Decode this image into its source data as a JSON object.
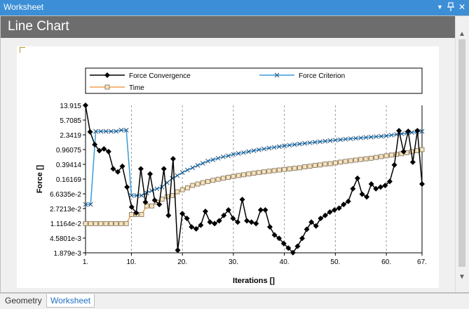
{
  "window": {
    "title": "Worksheet",
    "pin_icon": "pin-icon",
    "close_icon": "close-icon",
    "menu_icon": "dropdown-arrow-icon"
  },
  "header": {
    "title": "Line Chart"
  },
  "tabs": [
    {
      "label": "Geometry"
    },
    {
      "label": "Worksheet"
    }
  ],
  "colors": {
    "titlebar": "#3c8fd6",
    "header": "#6d6d6d",
    "criterion": "#3c9ad8",
    "time": "#f0a050",
    "time_fill": "#f5e3c0",
    "convergence": "#000000"
  },
  "chart_data": {
    "type": "line",
    "xlabel": "Iterations []",
    "ylabel": "Force []",
    "y_scale": "log",
    "x_range": [
      1,
      67
    ],
    "y_range": [
      0.001879,
      13.915
    ],
    "x_ticks": [
      "1.",
      "10.",
      "20.",
      "30.",
      "40.",
      "50.",
      "60.",
      "67."
    ],
    "y_ticks": [
      "13.915",
      "5.7085",
      "2.3419",
      "0.96075",
      "0.39414",
      "0.16169",
      "6.6335e-2",
      "2.7213e-2",
      "1.1164e-2",
      "4.5801e-3",
      "1.879e-3"
    ],
    "grid": "vertical dashed",
    "legend_position": "top",
    "series": [
      {
        "name": "Force Convergence",
        "marker": "diamond",
        "values": [
          13.9,
          2.8,
          1.3,
          0.9,
          1.0,
          0.85,
          0.3,
          0.25,
          0.35,
          0.1,
          0.03,
          0.021,
          0.3,
          0.04,
          0.22,
          0.045,
          0.035,
          0.3,
          0.018,
          0.55,
          0.0022,
          0.02,
          0.015,
          0.009,
          0.008,
          0.01,
          0.023,
          0.012,
          0.011,
          0.013,
          0.018,
          0.025,
          0.015,
          0.012,
          0.047,
          0.013,
          0.012,
          0.011,
          0.025,
          0.025,
          0.009,
          0.0055,
          0.0045,
          0.0033,
          0.0025,
          0.0019,
          0.0028,
          0.0045,
          0.0078,
          0.012,
          0.0095,
          0.015,
          0.018,
          0.022,
          0.025,
          0.028,
          0.035,
          0.042,
          0.09,
          0.17,
          0.065,
          0.055,
          0.12,
          0.09,
          0.1,
          0.11,
          0.14,
          0.38,
          3.0,
          0.85,
          2.9,
          0.45,
          3.0,
          0.12
        ]
      },
      {
        "name": "Force Criterion",
        "marker": "x",
        "values": [
          0.035,
          0.035,
          2.9,
          2.9,
          2.9,
          2.9,
          2.9,
          3.1,
          3.1,
          0.06,
          0.06,
          0.06,
          0.07,
          0.08,
          0.09,
          0.1,
          0.13,
          0.17,
          0.2,
          0.24,
          0.28,
          0.32,
          0.37,
          0.42,
          0.48,
          0.52,
          0.57,
          0.62,
          0.66,
          0.72,
          0.76,
          0.8,
          0.85,
          0.9,
          0.95,
          1.0,
          1.05,
          1.1,
          1.15,
          1.2,
          1.25,
          1.3,
          1.35,
          1.4,
          1.45,
          1.5,
          1.55,
          1.6,
          1.65,
          1.7,
          1.75,
          1.8,
          1.85,
          1.9,
          1.95,
          2.0,
          2.05,
          2.1,
          2.15,
          2.2,
          2.3,
          2.4,
          2.5,
          2.6,
          2.7,
          2.8,
          2.9
        ]
      },
      {
        "name": "Time",
        "marker": "square",
        "values": [
          0.011,
          0.011,
          0.011,
          0.011,
          0.011,
          0.011,
          0.011,
          0.011,
          0.011,
          0.019,
          0.019,
          0.019,
          0.032,
          0.032,
          0.04,
          0.048,
          0.056,
          0.06,
          0.075,
          0.085,
          0.095,
          0.11,
          0.12,
          0.13,
          0.14,
          0.15,
          0.16,
          0.17,
          0.18,
          0.19,
          0.2,
          0.21,
          0.22,
          0.23,
          0.24,
          0.25,
          0.26,
          0.27,
          0.28,
          0.29,
          0.3,
          0.31,
          0.32,
          0.34,
          0.35,
          0.37,
          0.38,
          0.4,
          0.41,
          0.43,
          0.45,
          0.47,
          0.49,
          0.51,
          0.53,
          0.55,
          0.57,
          0.6,
          0.63,
          0.66,
          0.69,
          0.72,
          0.75,
          0.8,
          0.85,
          0.9,
          0.96
        ]
      }
    ]
  }
}
